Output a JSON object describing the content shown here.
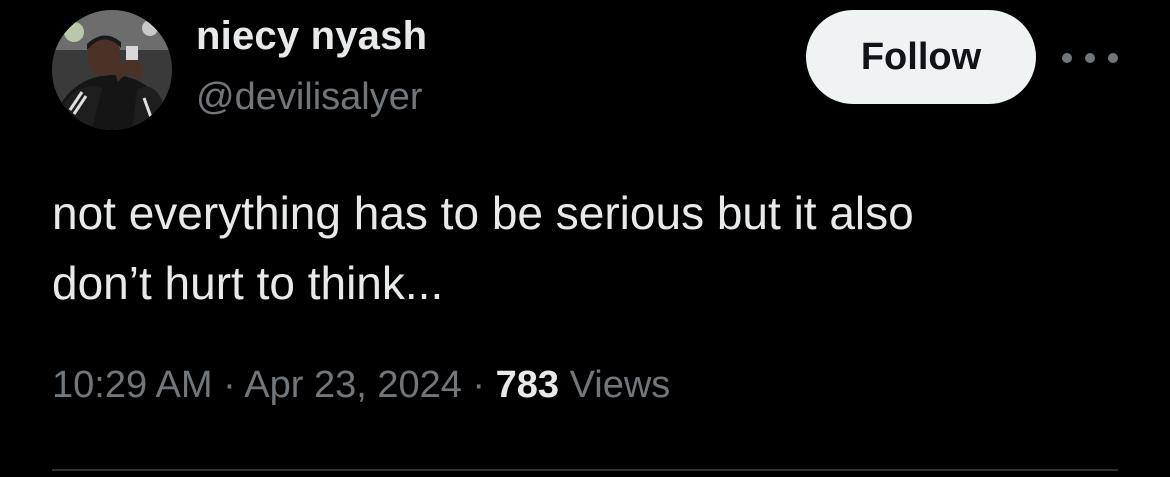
{
  "user": {
    "display_name": "niecy nyash",
    "handle": "@devilisalyer",
    "avatar_icon": "profile-photo"
  },
  "actions": {
    "follow_label": "Follow",
    "more_icon": "more-horizontal-icon"
  },
  "tweet": {
    "text_lines": [
      "not everything has to be serious but it also",
      "don’t hurt to think..."
    ]
  },
  "meta": {
    "time": "10:29 AM",
    "separator": "·",
    "date": "Apr 23, 2024",
    "views_count": "783",
    "views_label": "Views"
  },
  "colors": {
    "background": "#000000",
    "primary_text": "#e7e9ea",
    "secondary_text": "#71767b",
    "follow_button_bg": "#eff3f4",
    "divider": "#2f3336"
  }
}
